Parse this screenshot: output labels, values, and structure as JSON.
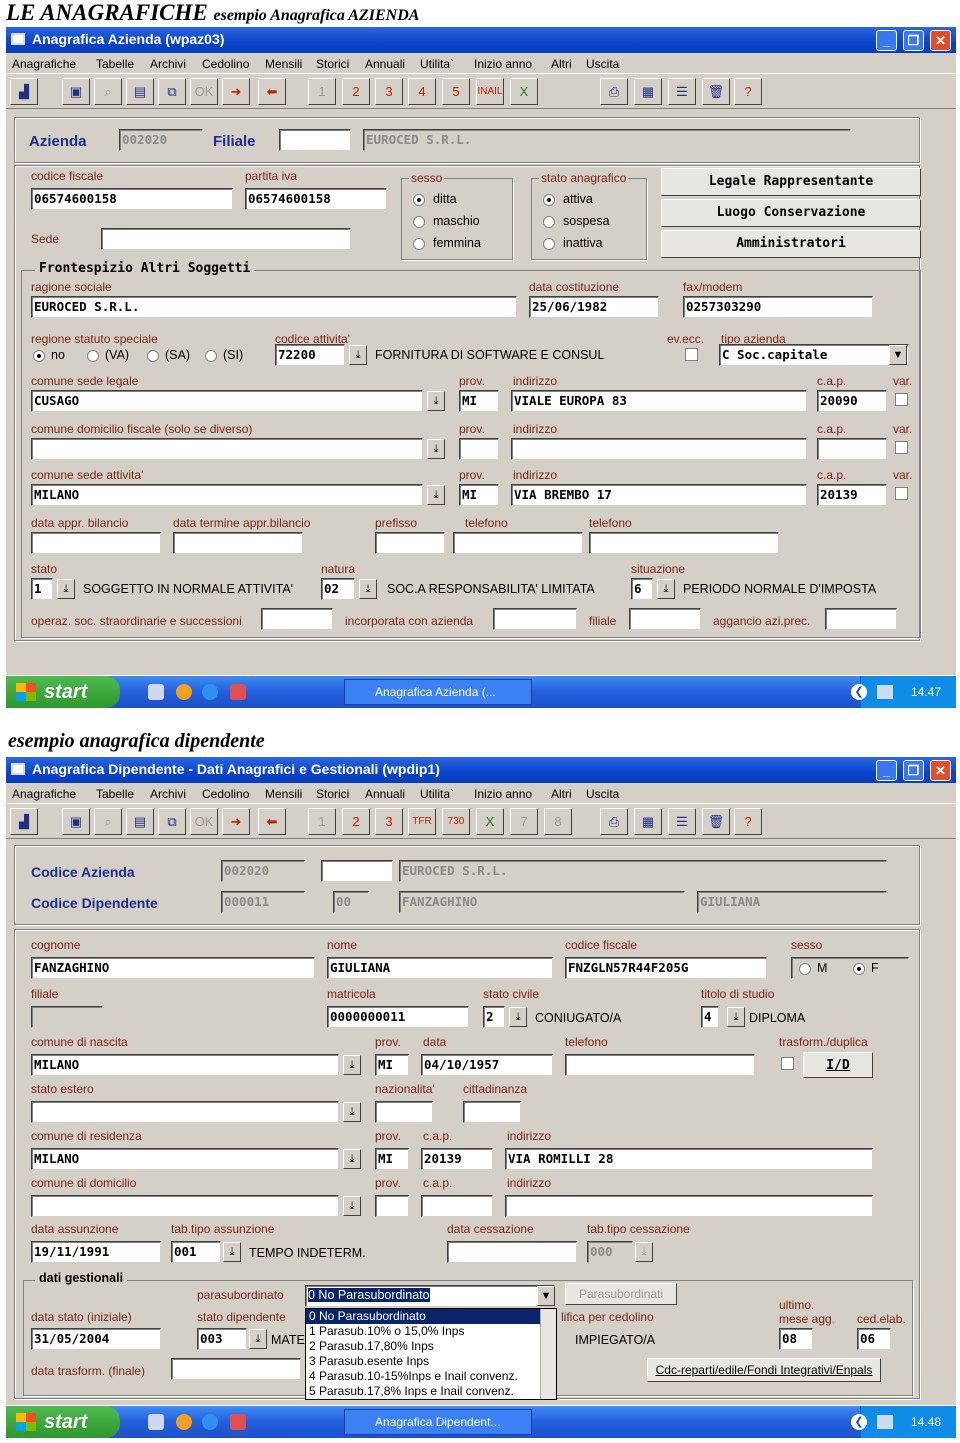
{
  "heading1": {
    "main": "LE ANAGRAFICHE",
    "sub": "esempio Anagrafica AZIENDA"
  },
  "heading2": "esempio anagrafica dipendente",
  "menu": [
    "Anagrafiche",
    "Tabelle",
    "Archivi",
    "Cedolino",
    "Mensili",
    "Storici",
    "Annuali",
    "Utilita`",
    "Inizio anno",
    "Altri",
    "Uscita"
  ],
  "win1": {
    "title": "Anagrafica Azienda (wpaz03)",
    "toolbar": [
      "1",
      "2",
      "3",
      "4",
      "5",
      "INAIL"
    ],
    "azienda": {
      "label": "Azienda",
      "value": "002020",
      "filiale_label": "Filiale",
      "filiale": "",
      "ragione": "EUROCED S.R.L."
    },
    "cf": {
      "label": "codice fiscale",
      "value": "06574600158"
    },
    "piva": {
      "label": "partita iva",
      "value": "06574600158"
    },
    "sede": {
      "label": "Sede",
      "value": ""
    },
    "sesso": {
      "label": "sesso",
      "options": [
        "ditta",
        "maschio",
        "femmina"
      ]
    },
    "stato": {
      "label": "stato anagrafico",
      "options": [
        "attiva",
        "sospesa",
        "inattiva"
      ]
    },
    "buttons": [
      "Legale Rappresentante",
      "Luogo Conservazione",
      "Amministratori"
    ],
    "frontespizio": "Frontespizio Altri Soggetti",
    "ragione_label": "ragione sociale",
    "ragione_value": "EUROCED S.R.L.",
    "data_cost_label": "data costituzione",
    "data_cost": "25/06/1982",
    "fax_label": "fax/modem",
    "fax": "0257303290",
    "regione_label": "regione statuto speciale",
    "regione_opts": [
      "no",
      "(VA)",
      "(SA)",
      "(SI)"
    ],
    "cod_att_label": "codice attivita'",
    "cod_att": "72200",
    "cod_att_desc": "FORNITURA DI SOFTWARE E CONSUL",
    "evecc_label": "ev.ecc.",
    "tipo_label": "tipo azienda",
    "tipo": "C Soc.capitale",
    "legale_label": "comune sede legale",
    "legale": "CUSAGO",
    "prov_label": "prov.",
    "legale_prov": "MI",
    "ind_label": "indirizzo",
    "legale_ind": "VIALE EUROPA 83",
    "cap_label": "c.a.p.",
    "legale_cap": "20090",
    "var_label": "var.",
    "domfis_label": "comune domicilio fiscale (solo se diverso)",
    "sedeatt_label": "comune sede attivita'",
    "sedeatt": "MILANO",
    "sedeatt_prov": "MI",
    "sedeatt_ind": "VIA BREMBO 17",
    "sedeatt_cap": "20139",
    "bil_label": "data appr. bilancio",
    "bilterm_label": "data termine appr.bilancio",
    "prefisso_label": "prefisso",
    "tel1_label": "telefono",
    "tel2_label": "telefono",
    "stato2_label": "stato",
    "stato2": "1",
    "stato2_desc": "SOGGETTO IN NORMALE ATTIVITA'",
    "natura_label": "natura",
    "natura": "02",
    "natura_desc": "SOC.A RESPONSABILITA' LIMITATA",
    "situaz_label": "situazione",
    "situaz": "6",
    "situaz_desc": "PERIODO NORMALE D'IMPOSTA",
    "operaz_label": "operaz. soc. straordinarie e successioni",
    "incorp_label": "incorporata con azienda",
    "filiale2_label": "filiale",
    "aggancio_label": "aggancio azi.prec."
  },
  "task1": {
    "start": "start",
    "task": "Anagrafica Azienda (...",
    "time": "14.47"
  },
  "win2": {
    "title": "Anagrafica Dipendente - Dati Anagrafici e Gestionali (wpdip1)",
    "toolbar": [
      "1",
      "2",
      "3",
      "TFR",
      "730",
      "7",
      "8"
    ],
    "codaz_label": "Codice Azienda",
    "codaz": "002020",
    "codaz2": "",
    "codaz_ragione": "EUROCED S.R.L.",
    "coddip_label": "Codice Dipendente",
    "coddip": "000011",
    "coddip2": "00",
    "coddip_cogn": "FANZAGHINO",
    "coddip_nome": "GIULIANA",
    "cognome_label": "cognome",
    "cognome": "FANZAGHINO",
    "nome_label": "nome",
    "nome": "GIULIANA",
    "cf_label": "codice fiscale",
    "cf": "FNZGLN57R44F205G",
    "sesso_label": "sesso",
    "sesso_opts": [
      "M",
      "F"
    ],
    "filiale_label": "filiale",
    "matricola_label": "matricola",
    "matricola": "0000000011",
    "civile_label": "stato civile",
    "civile": "2",
    "civile_desc": "CONIUGATO/A",
    "titolo_label": "titolo di studio",
    "titolo": "4",
    "titolo_desc": "DIPLOMA",
    "nascita_label": "comune di nascita",
    "nascita": "MILANO",
    "prov_label": "prov.",
    "nascita_prov": "MI",
    "data_label": "data",
    "nascita_data": "04/10/1957",
    "tel_label": "telefono",
    "trasf_label": "trasform./duplica",
    "id_btn": "I/D",
    "estero_label": "stato estero",
    "naz_label": "nazionalita'",
    "citt_label": "cittadinanza",
    "res_label": "comune di residenza",
    "res": "MILANO",
    "res_prov": "MI",
    "cap_label": "c.a.p.",
    "res_cap": "20139",
    "ind_label": "indirizzo",
    "res_ind": "VIA ROMILLI 28",
    "dom_label": "comune di domicilio",
    "ass_label": "data assunzione",
    "ass": "19/11/1991",
    "tipoass_label": "tab.tipo assunzione",
    "tipoass": "001",
    "tipoass_desc": "TEMPO INDETERM.",
    "cess_label": "data cessazione",
    "tipocess_label": "tab.tipo cessazione",
    "tipocess": "000",
    "gest_label": "dati gestionali",
    "para_label": "parasubordinato",
    "para": "0 No Parasubordinato",
    "para_btn": "Parasubordinati",
    "para_list": [
      "0 No Parasubordinato",
      "1 Parasub.10% o 15,0% Inps",
      "2 Parasub.17,80% Inps",
      "3 Parasub.esente Inps",
      "4 Parasub.10-15%Inps e Inail convenz.",
      "5 Parasub.17,8% Inps e Inail convenz."
    ],
    "statoin_label": "data stato (iniziale)",
    "statoin": "31/05/2004",
    "statodip_label": "stato dipendente",
    "statodip": "003",
    "statodip_desc": "MATE",
    "qual_label": "lifica per cedolino",
    "qual_desc": "IMPIEGATO/A",
    "ultimo_label": "ultimo.",
    "mese_label": "mese agg.",
    "mese": "08",
    "ced_label": "ced.elab.",
    "ced": "06",
    "trasfin_label": "data trasform. (finale)",
    "cdc_btn": "Cdc-reparti/edile/Fondi Integrativi/Enpals"
  },
  "task2": {
    "start": "start",
    "task": "Anagrafica Dipendent...",
    "time": "14.48"
  }
}
